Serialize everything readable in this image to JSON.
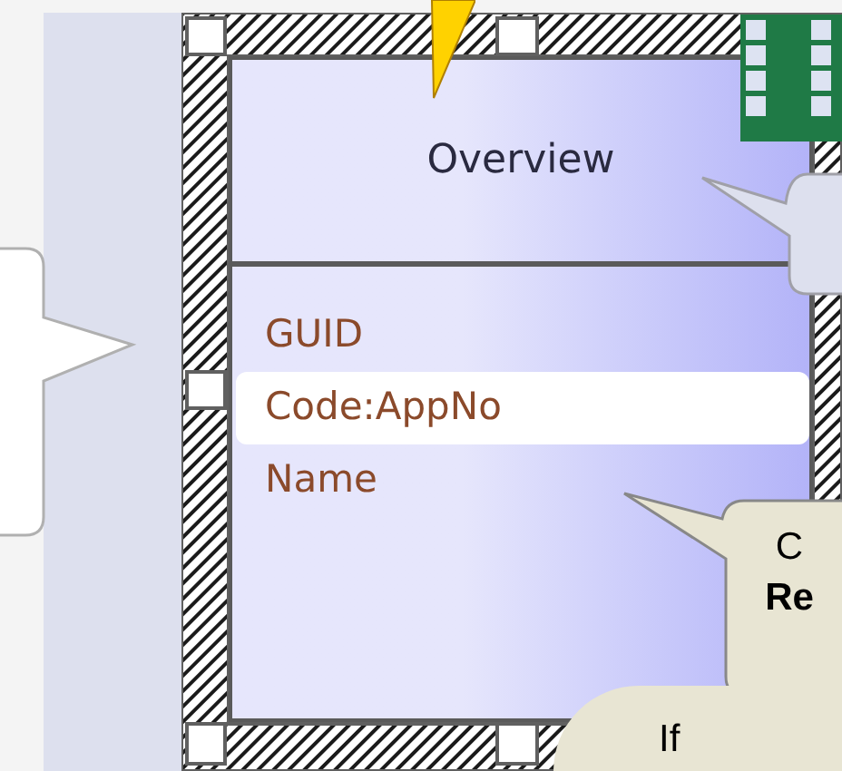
{
  "element": {
    "title": "Overview",
    "attributes": [
      {
        "name": "GUID",
        "selected": false
      },
      {
        "name": "Code:AppNo",
        "selected": true
      },
      {
        "name": "Name",
        "selected": false
      }
    ]
  },
  "callouts": [
    {
      "kind": "note",
      "lines": [
        "C",
        "Re"
      ]
    },
    {
      "kind": "bubble",
      "lines": [
        "If"
      ]
    }
  ]
}
